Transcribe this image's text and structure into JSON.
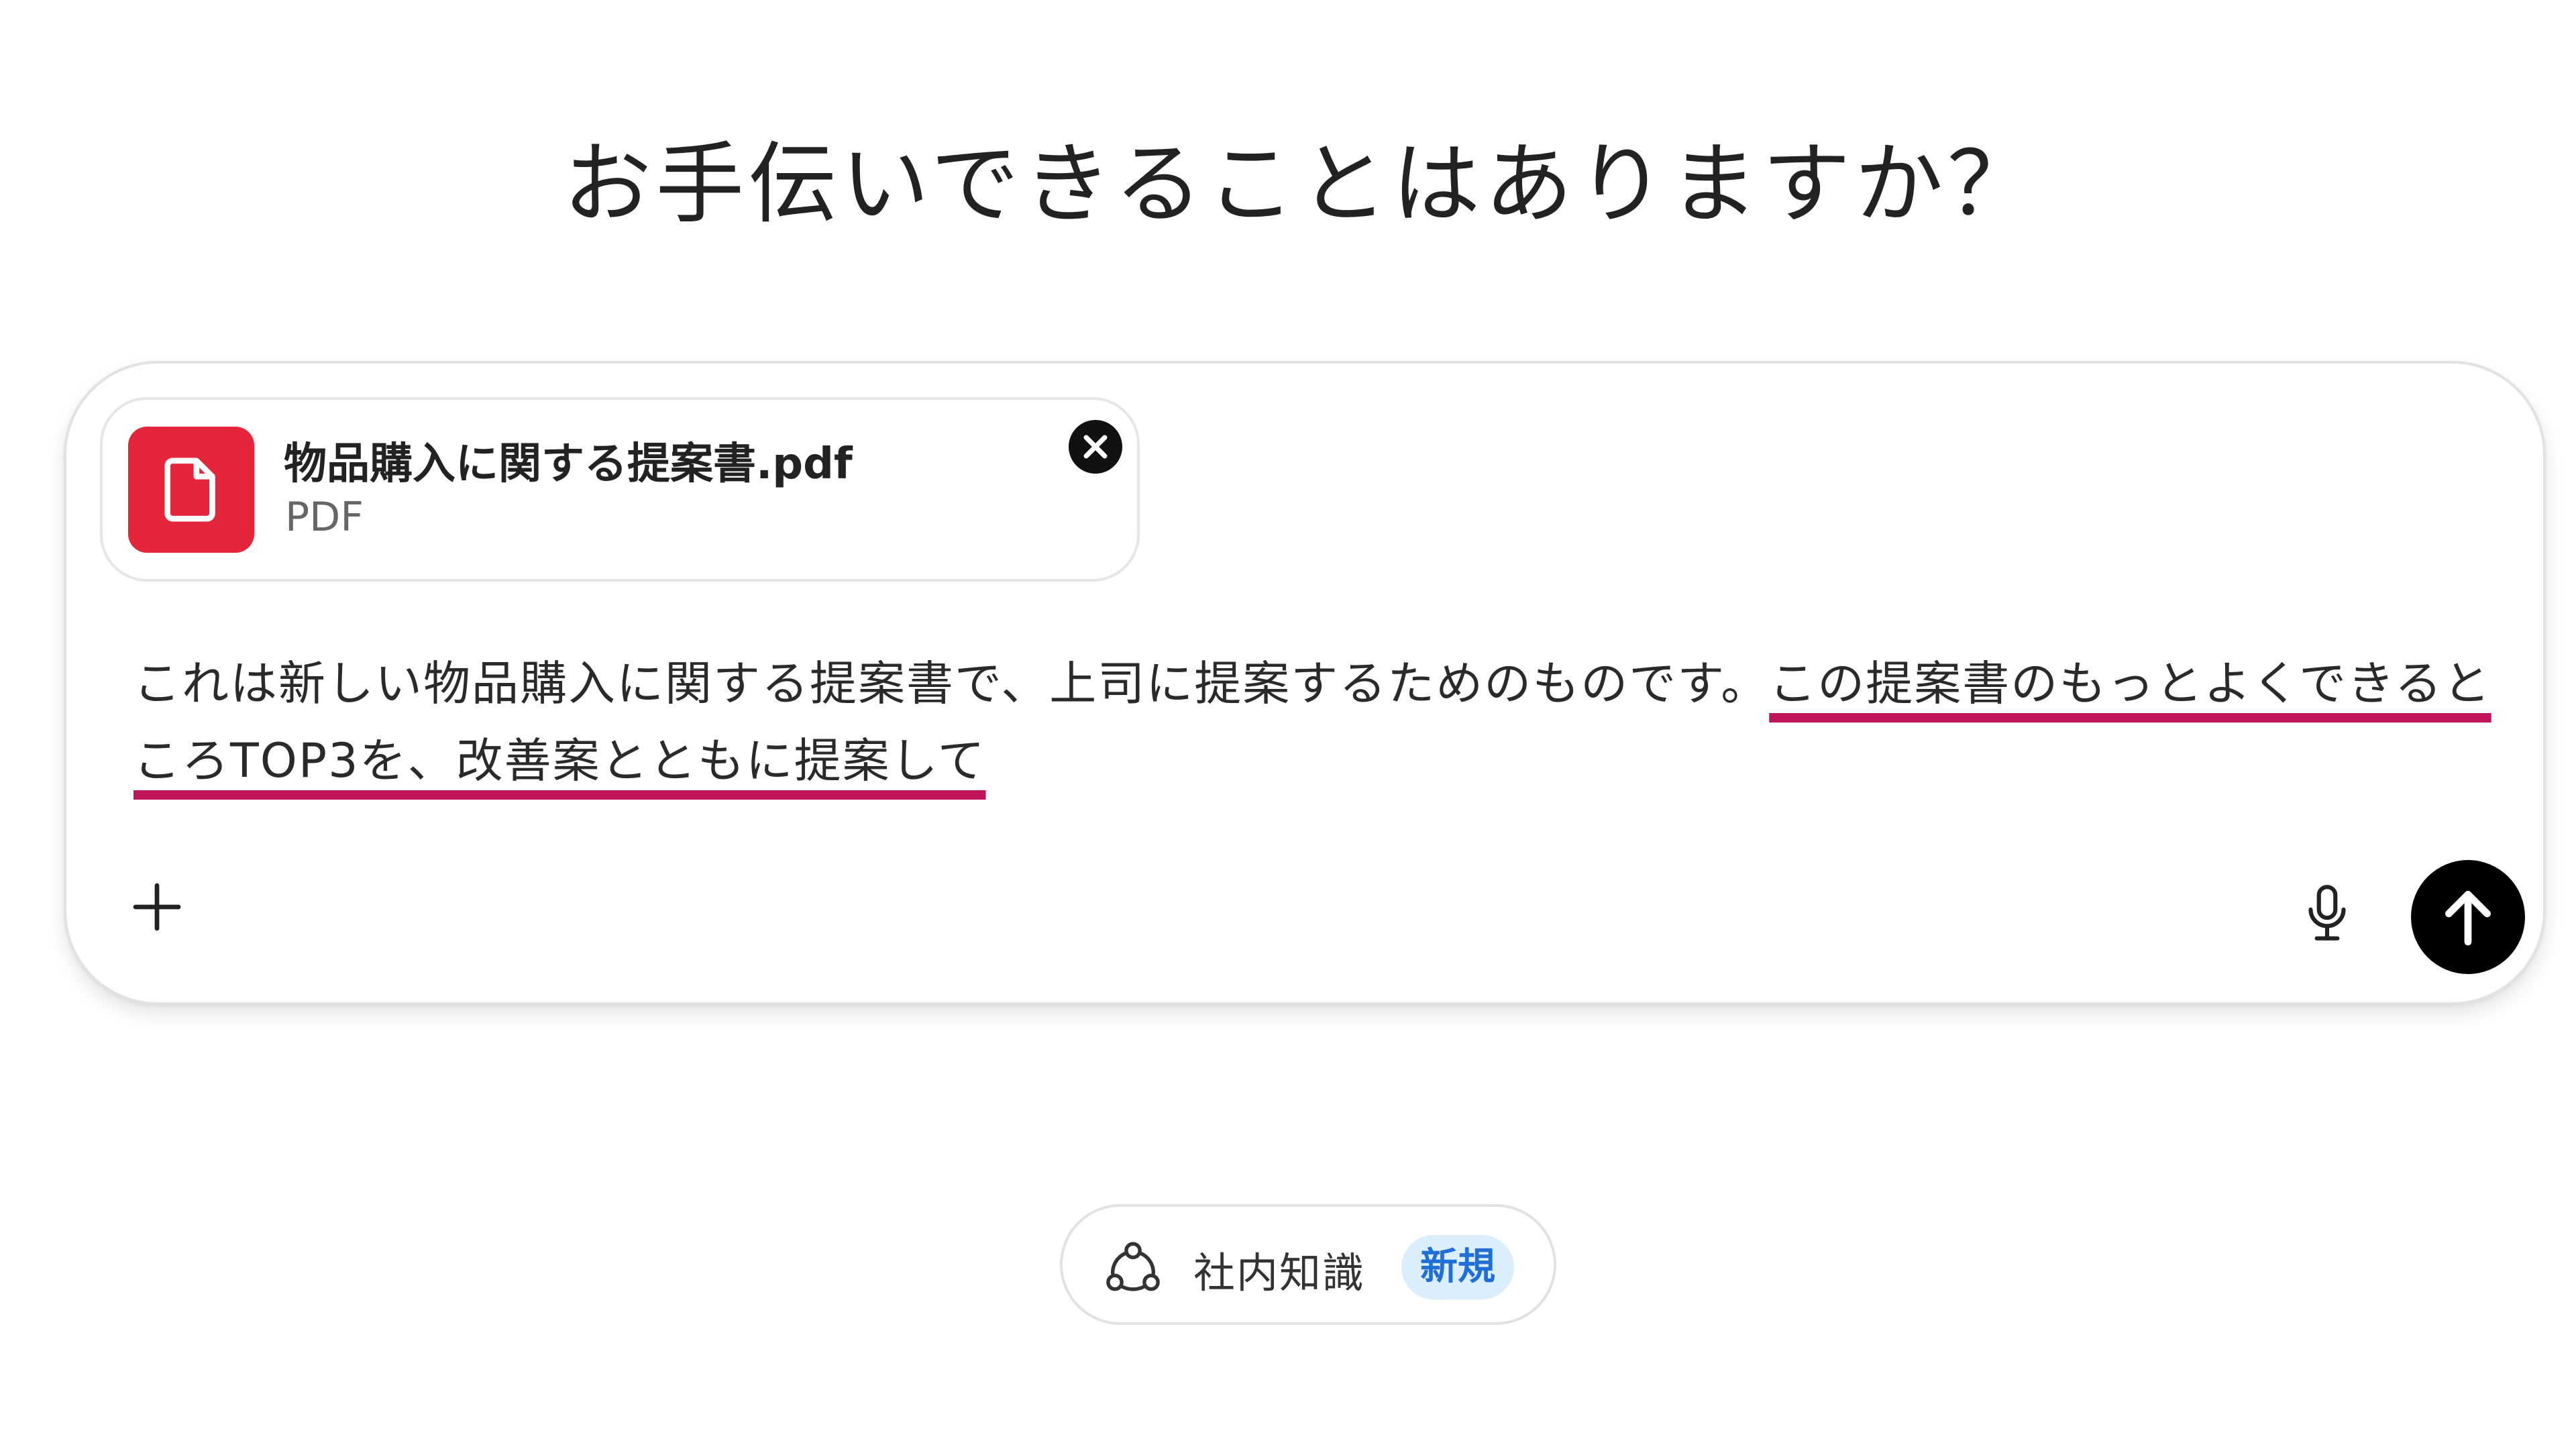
{
  "heading": "お手伝いできることはありますか？",
  "attachment": {
    "file_name": "物品購入に関する提案書.pdf",
    "file_type": "PDF",
    "icon": "file-icon",
    "icon_bg_color": "#e4253a"
  },
  "prompt": {
    "text_plain": "これは新しい物品購入に関する提案書で、上司に提案するためのものです。",
    "text_highlighted": "この提案書のもっとよくできるところTOP3を、改善案とともに提案して",
    "highlight_color": "#c0155c"
  },
  "toolbar": {
    "plus_icon": "plus-icon",
    "mic_icon": "microphone-icon",
    "send_icon": "arrow-up-icon"
  },
  "knowledge": {
    "label": "社内知識",
    "badge": "新規",
    "icon": "knowledge-network-icon"
  }
}
